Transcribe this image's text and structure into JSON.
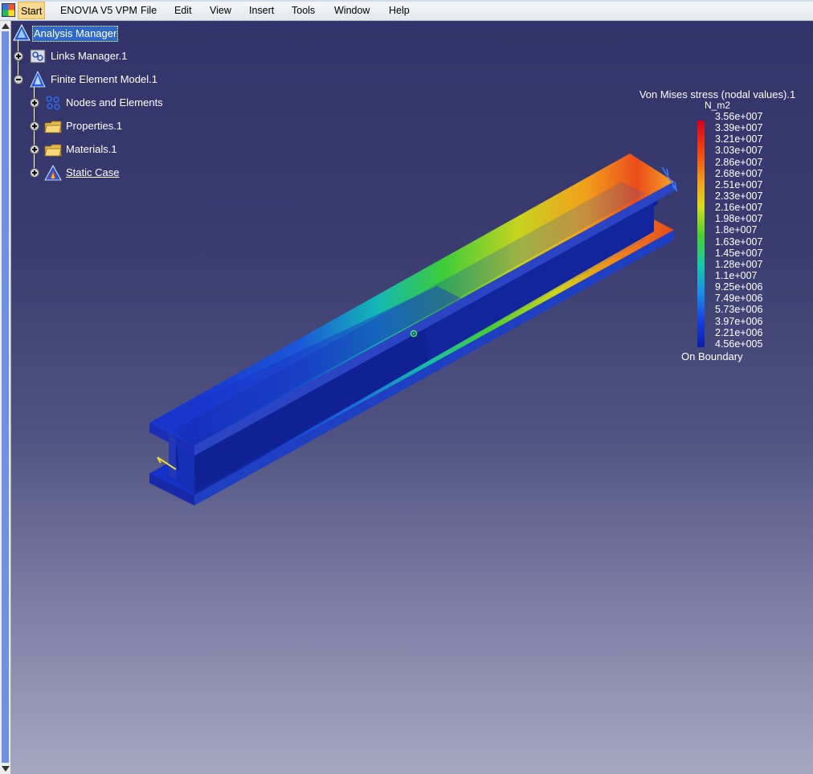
{
  "menu": {
    "start": "Start",
    "enovia": "ENOVIA V5 VPM",
    "file": "File",
    "edit": "Edit",
    "view": "View",
    "insert": "Insert",
    "tools": "Tools",
    "window": "Window",
    "help": "Help"
  },
  "tree": {
    "root": {
      "label": "Analysis Manager",
      "icon": "analysis-manager-icon"
    },
    "links_manager": {
      "label": "Links Manager.1",
      "icon": "links-manager-icon"
    },
    "fem": {
      "label": "Finite Element Model.1",
      "icon": "finite-element-model-icon"
    },
    "nodes": {
      "label": "Nodes and Elements",
      "icon": "nodes-elements-icon"
    },
    "properties": {
      "label": "Properties.1",
      "icon": "folder-icon"
    },
    "materials": {
      "label": "Materials.1",
      "icon": "folder-icon"
    },
    "static_case": {
      "label": "Static Case",
      "icon": "static-case-icon"
    }
  },
  "legend": {
    "title": "Von Mises stress (nodal values).1",
    "unit": "N_m2",
    "values": [
      "3.56e+007",
      "3.39e+007",
      "3.21e+007",
      "3.03e+007",
      "2.86e+007",
      "2.68e+007",
      "2.51e+007",
      "2.33e+007",
      "2.16e+007",
      "1.98e+007",
      "1.8e+007",
      "1.63e+007",
      "1.45e+007",
      "1.28e+007",
      "1.1e+007",
      "9.25e+006",
      "7.49e+006",
      "5.73e+006",
      "3.97e+006",
      "2.21e+006",
      "4.56e+005"
    ],
    "footer": "On Boundary"
  }
}
